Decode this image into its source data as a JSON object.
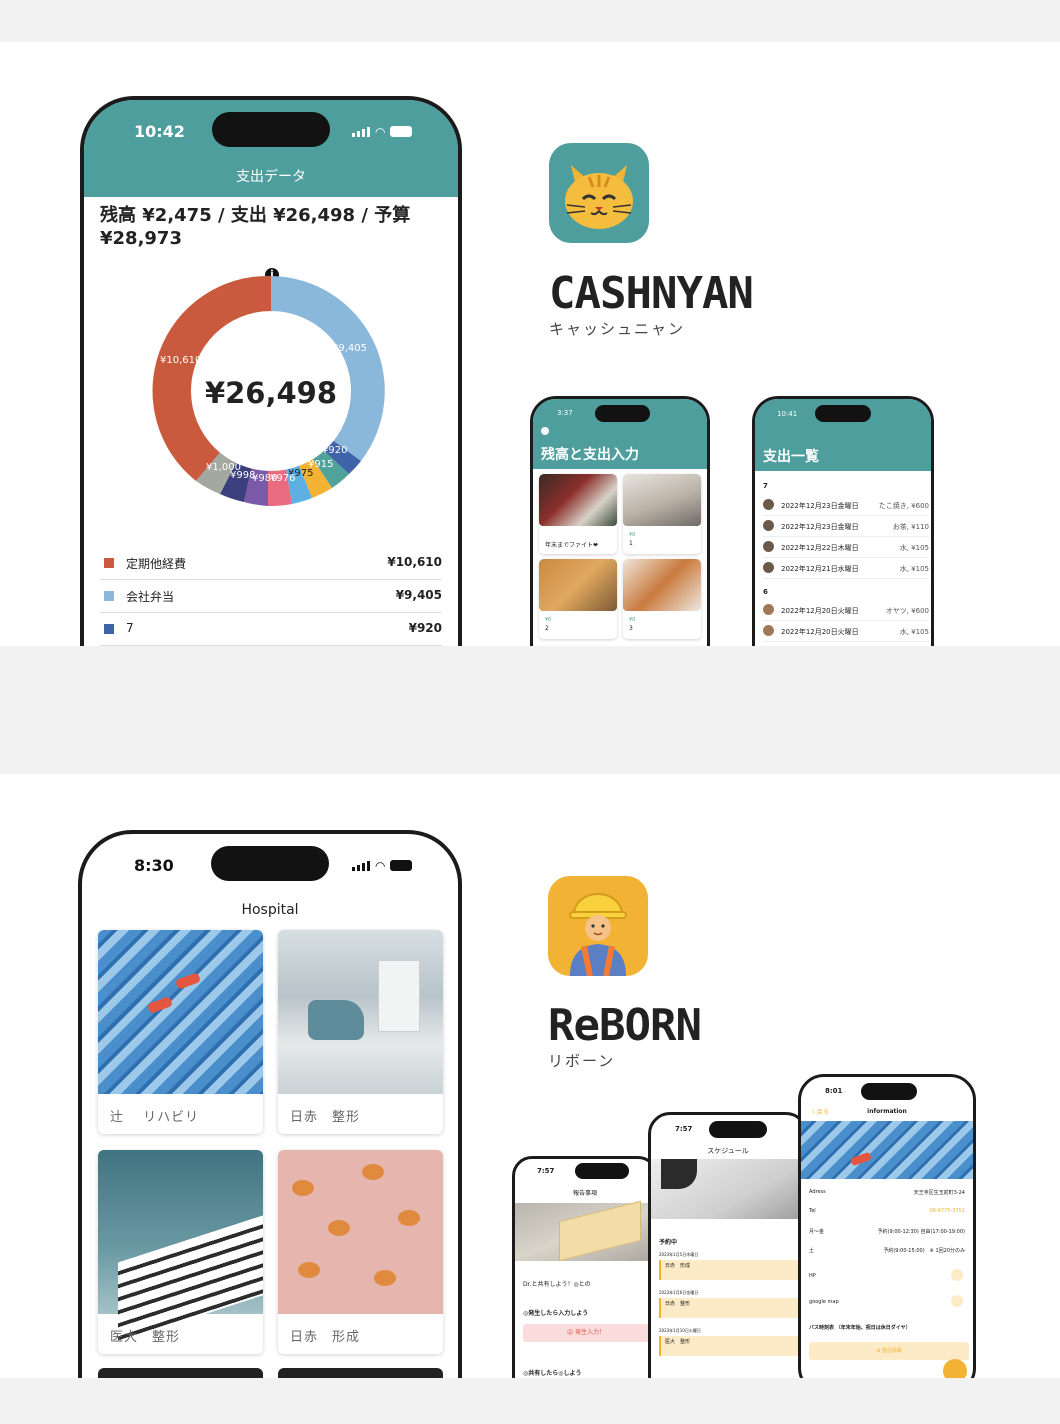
{
  "cashnyan": {
    "phone": {
      "time": "10:42",
      "title": "支出データ",
      "balance_line": "残高 ¥2,475 / 支出 ¥26,498 / 予算 ¥28,973",
      "total": "¥26,498",
      "donut_labels": [
        "¥10,610",
        "¥9,405",
        "¥920",
        "¥915",
        "¥975",
        "¥1,000",
        "¥998",
        "¥980",
        "¥976"
      ],
      "legend": [
        {
          "label": "定期他経費",
          "amount": "¥10,610",
          "color": "#c95a3d"
        },
        {
          "label": "会社弁当",
          "amount": "¥9,405",
          "color": "#8ab8db"
        },
        {
          "label": "7",
          "amount": "¥920",
          "color": "#3e63a8"
        }
      ]
    },
    "app_name": "CASHNYAN",
    "app_kana": "キャッシュニャン",
    "screen_input": {
      "time": "3:37",
      "title": "残高と支出入力",
      "cards": [
        {
          "caption": "年末までファイト❤"
        },
        {
          "caption": "¥0",
          "sub": "1"
        },
        {
          "caption": "¥0",
          "sub": "2"
        },
        {
          "caption": "¥0",
          "sub": "3"
        }
      ]
    },
    "screen_list": {
      "time": "10:41",
      "title": "支出一覧",
      "groups": [
        {
          "heading": "7",
          "rows": [
            {
              "date": "2022年12月23日金曜日",
              "note": "たこ焼き, ¥600"
            },
            {
              "date": "2022年12月23日金曜日",
              "note": "お茶, ¥110"
            },
            {
              "date": "2022年12月22日木曜日",
              "note": "水, ¥105"
            },
            {
              "date": "2022年12月21日水曜日",
              "note": "水, ¥105"
            }
          ]
        },
        {
          "heading": "6",
          "rows": [
            {
              "date": "2022年12月20日火曜日",
              "note": "オヤツ, ¥600"
            },
            {
              "date": "2022年12月20日火曜日",
              "note": "水, ¥105"
            }
          ]
        }
      ]
    }
  },
  "reborn": {
    "phone": {
      "time": "8:30",
      "title": "Hospital",
      "cards": [
        {
          "caption": "辻　 リハビリ"
        },
        {
          "caption": "日赤　整形"
        },
        {
          "caption": "医大　整形"
        },
        {
          "caption": "日赤　形成"
        }
      ]
    },
    "app_name": "ReBORN",
    "app_kana": "リボーン",
    "screen_report": {
      "time": "7:57",
      "title": "報告事項",
      "line1": "Dr.と共有しよう！◎との",
      "line2": "◎発生したら入力しよう",
      "button": "😮 発生入力！",
      "line3": "◎共有したら◎しよう"
    },
    "screen_schedule": {
      "time": "7:57",
      "title": "スケジュール",
      "section": "予約中",
      "items": [
        {
          "date": "2023年1月5日木曜日",
          "text": "日赤　形成"
        },
        {
          "date": "2023年1月6日金曜日",
          "text": "日赤　整形"
        },
        {
          "date": "2023年1月10日火曜日",
          "text": "医大　整形"
        }
      ]
    },
    "screen_info": {
      "time": "8:01",
      "back": "〈 戻る",
      "title": "information",
      "rows": [
        {
          "key": "Adress",
          "value": "天王寺区生玉前町3-24"
        },
        {
          "key": "Tel",
          "value": "06-6775-3751"
        },
        {
          "key": "月〜金",
          "value": "予約(9:00-12:30) 自由(17:00-19:00)"
        },
        {
          "key": "土",
          "value": "予約(9:00-15:00)　※ 1回20分のみ"
        },
        {
          "key": "HP",
          "value": ""
        },
        {
          "key": "google map",
          "value": ""
        },
        {
          "key": "バス時刻表 （年末年始、祝日は休日ダイヤ）",
          "value": ""
        }
      ],
      "button": "⊕ 登記情報"
    }
  },
  "colors": {
    "teal": "#4d9e9c",
    "orange": "#f2b233",
    "donut_red": "#c95a3d",
    "donut_blue": "#8ab8db"
  }
}
